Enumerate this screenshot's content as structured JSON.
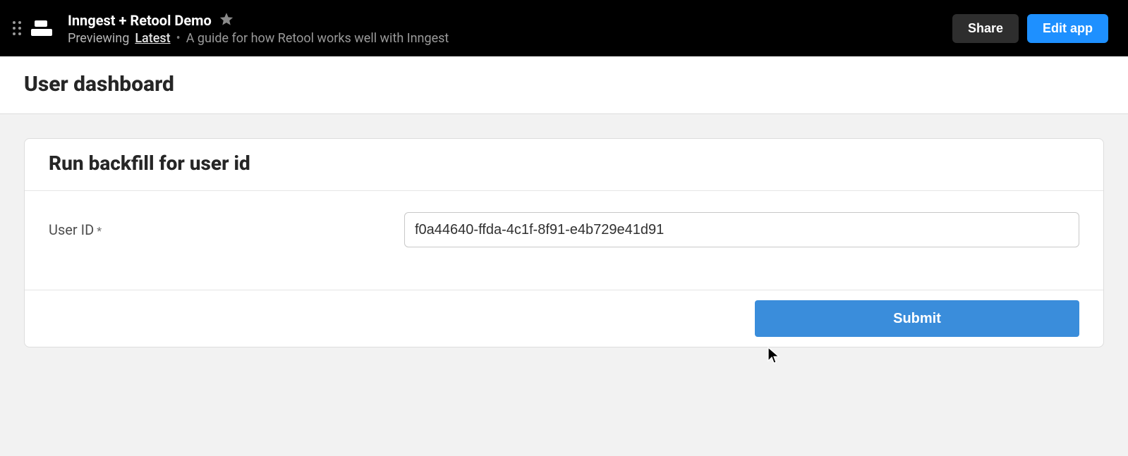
{
  "topbar": {
    "app_title": "Inngest + Retool Demo",
    "previewing_label": "Previewing",
    "version": "Latest",
    "description": "A guide for how Retool works well with Inngest",
    "share_label": "Share",
    "edit_label": "Edit app"
  },
  "page": {
    "title": "User dashboard"
  },
  "card": {
    "title": "Run backfill for user id",
    "field_label": "User ID",
    "required_mark": "*",
    "field_value": "f0a44640-ffda-4c1f-8f91-e4b729e41d91",
    "submit_label": "Submit"
  }
}
